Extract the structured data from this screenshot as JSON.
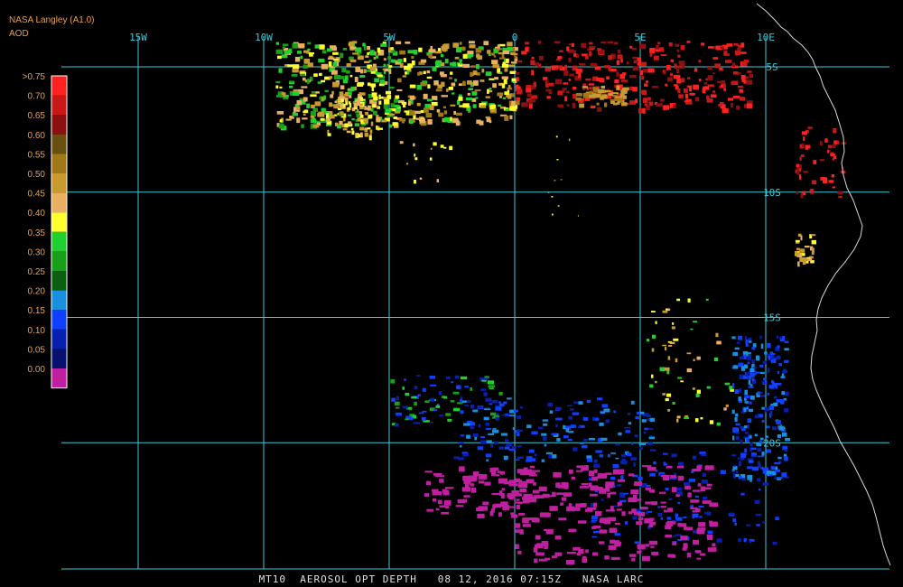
{
  "header": {
    "source": "NASA Langley (A1.0)",
    "product": "AOD"
  },
  "legend": {
    "labels": [
      ">0.75",
      "0.70",
      "0.65",
      "0.60",
      "0.55",
      "0.50",
      "0.45",
      "0.40",
      "0.35",
      "0.30",
      "0.25",
      "0.20",
      "0.15",
      "0.10",
      "0.05",
      "0.00"
    ],
    "colors": [
      "#ff2020",
      "#c81818",
      "#8c1010",
      "#6a5010",
      "#a07818",
      "#c89a30",
      "#e8b060",
      "#ffff30",
      "#20d030",
      "#18a018",
      "#0a6010",
      "#1890e0",
      "#1040ff",
      "#0820b0",
      "#081070",
      "#c020a0"
    ]
  },
  "axes": {
    "lon_labels": [
      {
        "text": "15W",
        "lon": -15
      },
      {
        "text": "10W",
        "lon": -10
      },
      {
        "text": "5W",
        "lon": -5
      },
      {
        "text": "0",
        "lon": 0
      },
      {
        "text": "5E",
        "lon": 5
      },
      {
        "text": "10E",
        "lon": 10
      }
    ],
    "lat_labels": [
      {
        "text": "5S",
        "lat": -5
      },
      {
        "text": "10S",
        "lat": -10
      },
      {
        "text": "15S",
        "lat": -15
      },
      {
        "text": "20S",
        "lat": -20
      }
    ],
    "grid_color": "#40c8d8"
  },
  "caption": "MT10  AEROSOL OPT DEPTH   08 12, 2016 07:15Z   NASA LARC"
}
